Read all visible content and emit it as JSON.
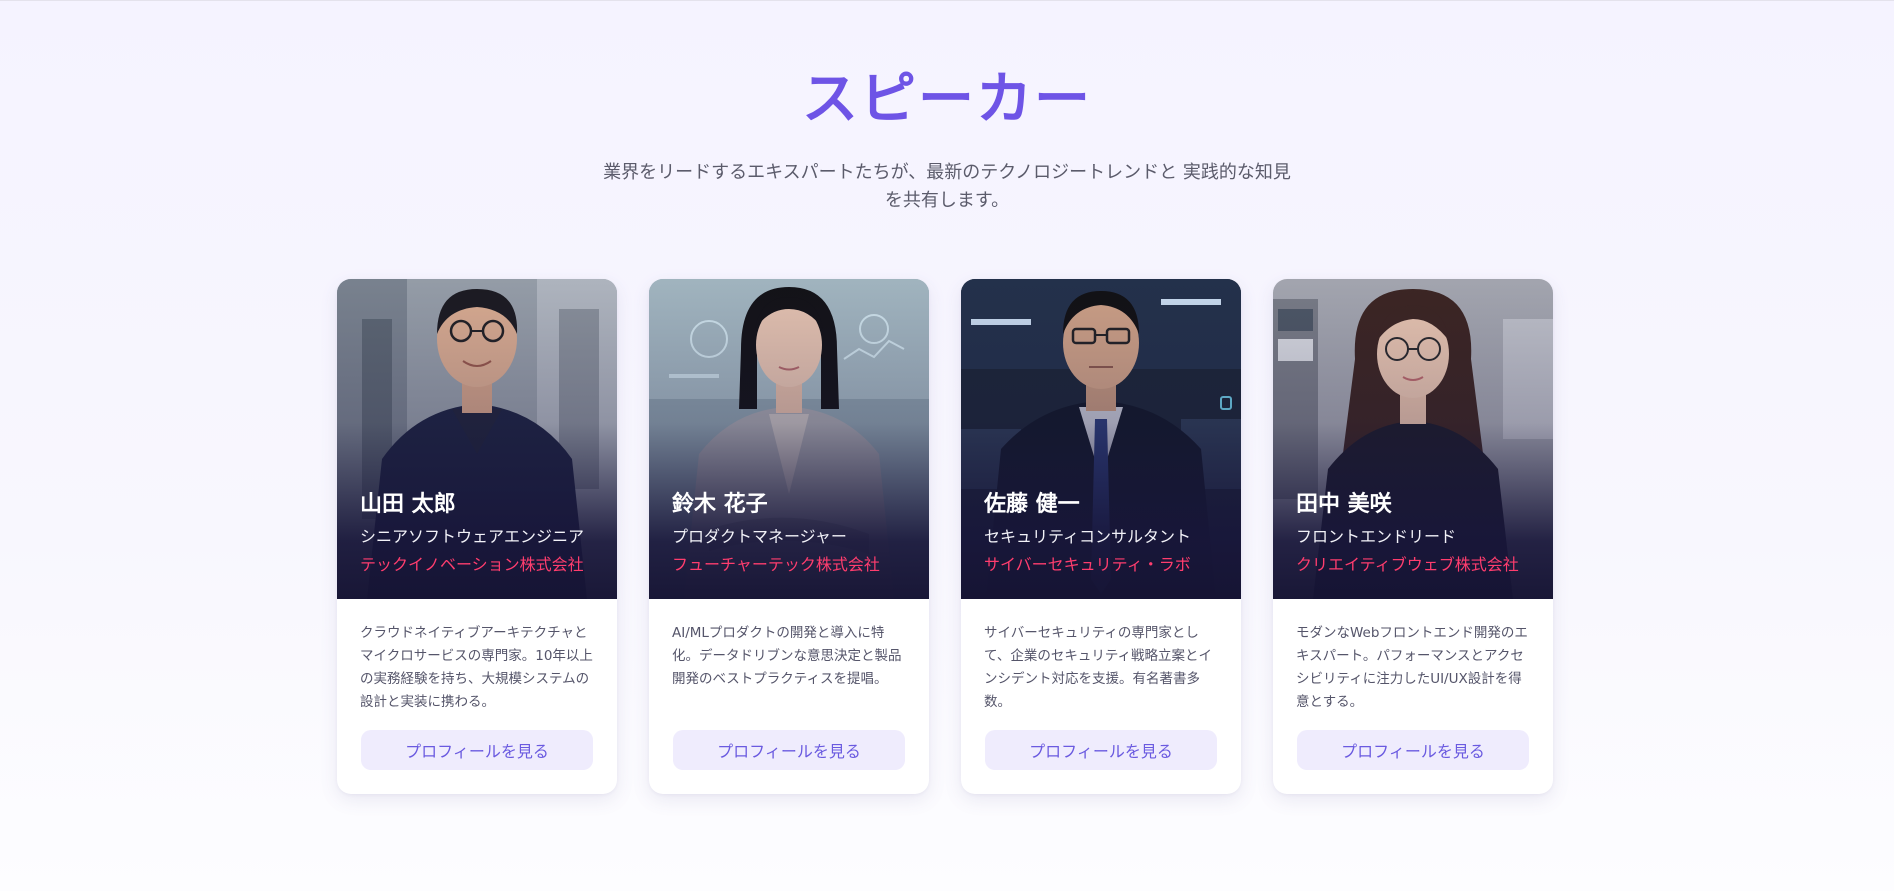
{
  "section": {
    "title": "スピーカー",
    "description": "業界をリードするエキスパートたちが、最新のテクノロジートレンドと 実践的な知見を共有します。"
  },
  "speakers": [
    {
      "name": "山田 太郎",
      "role": "シニアソフトウェアエンジニア",
      "company": "テックイノベーション株式会社",
      "bio": "クラウドネイティブアーキテクチャとマイクロサービスの専門家。10年以上の実務経験を持ち、大規模システムの設計と実装に携わる。",
      "button": "プロフィールを見る"
    },
    {
      "name": "鈴木 花子",
      "role": "プロダクトマネージャー",
      "company": "フューチャーテック株式会社",
      "bio": "AI/MLプロダクトの開発と導入に特化。データドリブンな意思決定と製品開発のベストプラクティスを提唱。",
      "button": "プロフィールを見る"
    },
    {
      "name": "佐藤 健一",
      "role": "セキュリティコンサルタント",
      "company": "サイバーセキュリティ・ラボ",
      "bio": "サイバーセキュリティの専門家として、企業のセキュリティ戦略立案とインシデント対応を支援。有名著書多数。",
      "button": "プロフィールを見る"
    },
    {
      "name": "田中 美咲",
      "role": "フロントエンドリード",
      "company": "クリエイティブウェブ株式会社",
      "bio": "モダンなWebフロントエンド開発のエキスパート。パフォーマンスとアクセシビリティに注力したUI/UX設計を得意とする。",
      "button": "プロフィールを見る"
    }
  ],
  "colors": {
    "accent": "#6e54e6",
    "company": "#ff3d6e",
    "button_bg": "#efecfd",
    "button_text": "#6a5ae0"
  }
}
